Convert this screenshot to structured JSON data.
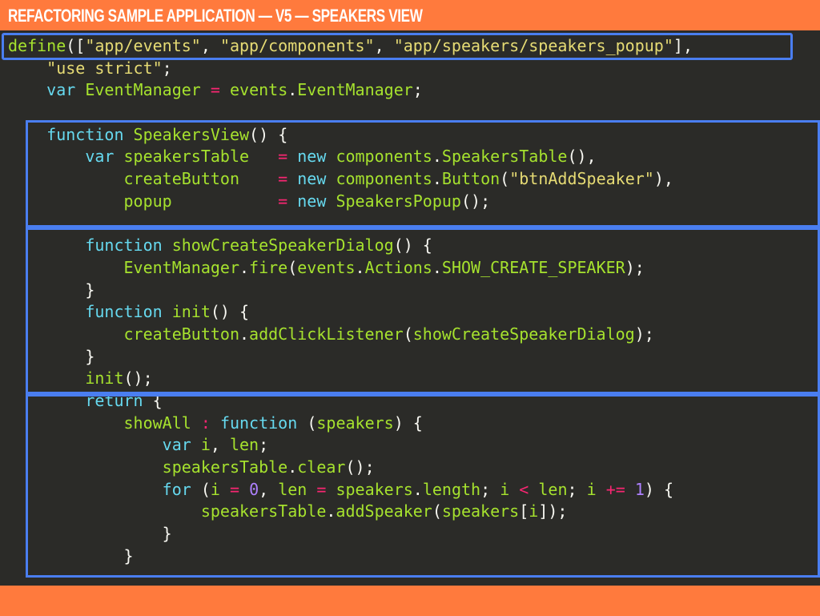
{
  "header": {
    "title": "Refactoring Sample Application — V5 — Speakers View"
  },
  "code_lines": [
    "define([\"app/events\", \"app/components\", \"app/speakers/speakers_popup\"],",
    "    \"use strict\";",
    "    var EventManager = events.EventManager;",
    "",
    "    function SpeakersView() {",
    "        var speakersTable   = new components.SpeakersTable(),",
    "            createButton    = new components.Button(\"btnAddSpeaker\"),",
    "            popup           = new SpeakersPopup();",
    "",
    "        function showCreateSpeakerDialog() {",
    "            EventManager.fire(events.Actions.SHOW_CREATE_SPEAKER);",
    "        }",
    "        function init() {",
    "            createButton.addClickListener(showCreateSpeakerDialog);",
    "        }",
    "        init();",
    "        return {",
    "            showAll : function (speakers) {",
    "                var i, len;",
    "                speakersTable.clear();",
    "                for (i = 0, len = speakers.length; i < len; i += 1) {",
    "                    speakersTable.addSpeaker(speakers[i]);",
    "                }",
    "            }"
  ],
  "colors": {
    "bar": "#ff7a3d",
    "background": "#2b2b28",
    "highlight_box": "#4a7ef0"
  }
}
